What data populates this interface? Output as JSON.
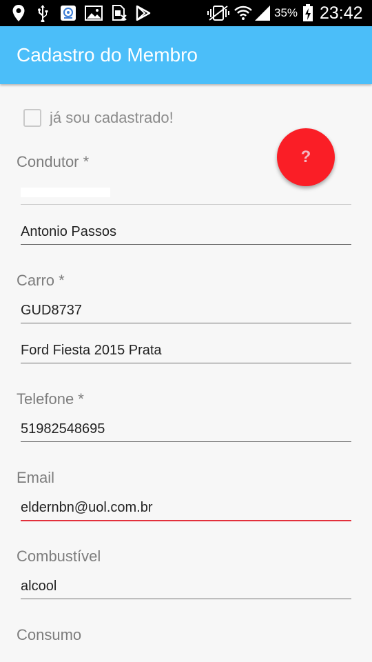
{
  "status_bar": {
    "battery_percent": "35%",
    "time": "23:42",
    "icons": [
      "location-icon",
      "usb-icon",
      "notification-app-icon",
      "image-icon",
      "sim-card-icon",
      "play-store-icon",
      "vibrate-icon",
      "wifi-icon",
      "signal-icon",
      "battery-charging-icon"
    ]
  },
  "app_bar": {
    "title": "Cadastro do Membro"
  },
  "form": {
    "already_registered_label": "já sou cadastrado!",
    "condutor_label": "Condutor *",
    "condutor_name": "Antonio Passos",
    "carro_label": "Carro *",
    "carro_plate": "GUD8737",
    "carro_model": "Ford Fiesta 2015 Prata",
    "telefone_label": "Telefone *",
    "telefone_value": "51982548695",
    "email_label": "Email",
    "email_value": "eldernbn@uol.com.br",
    "combustivel_label": "Combustível",
    "combustivel_value": "alcool",
    "consumo_label": "Consumo"
  },
  "fab": {
    "label": "?"
  },
  "colors": {
    "app_bar": "#4bbef9",
    "fab": "#fa1e26",
    "focused_underline": "#e2303b"
  }
}
